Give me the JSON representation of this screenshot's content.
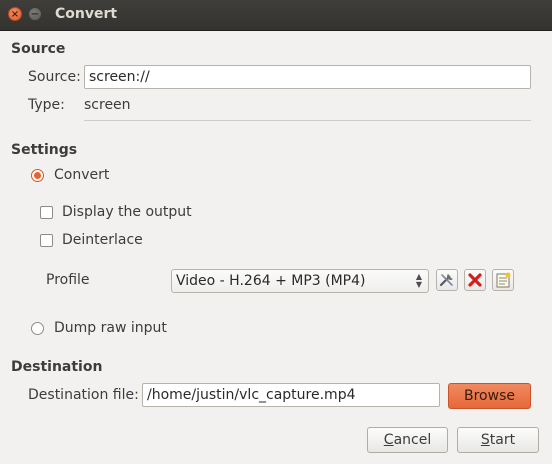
{
  "window": {
    "title": "Convert"
  },
  "source": {
    "section_label": "Source",
    "source_label": "Source:",
    "source_value": "screen://",
    "type_label": "Type:",
    "type_value": "screen"
  },
  "settings": {
    "section_label": "Settings",
    "convert_label": "Convert",
    "display_output_label": "Display the output",
    "deinterlace_label": "Deinterlace",
    "profile_label": "Profile",
    "profile_value": "Video - H.264 + MP3 (MP4)",
    "dump_raw_label": "Dump raw input"
  },
  "destination": {
    "section_label": "Destination",
    "file_label": "Destination file:",
    "file_value": "/home/justin/vlc_capture.mp4",
    "browse_label": "Browse"
  },
  "buttons": {
    "cancel_first": "C",
    "cancel_rest": "ancel",
    "start_first": "S",
    "start_rest": "tart"
  },
  "colors": {
    "accent": "#e8632e",
    "background": "#f2f1f0",
    "titlebar": "#3c3b37"
  },
  "icons": [
    "close-icon",
    "minimize-icon",
    "edit-profile-icon",
    "delete-profile-icon",
    "new-profile-icon"
  ],
  "state": {
    "convert_selected": true,
    "dump_raw_selected": false,
    "display_output_checked": false,
    "deinterlace_checked": false
  }
}
